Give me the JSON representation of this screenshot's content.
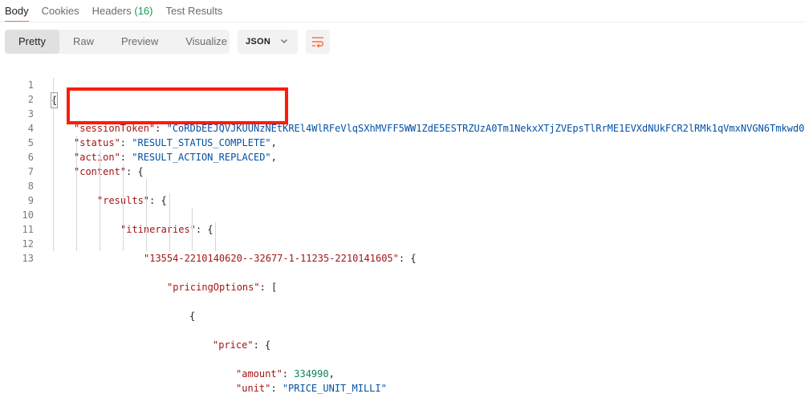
{
  "tabs": [
    {
      "label": "Body"
    },
    {
      "label": "Cookies"
    },
    {
      "label": "Headers",
      "count": "(16)"
    },
    {
      "label": "Test Results"
    }
  ],
  "view_modes": [
    "Pretty",
    "Raw",
    "Preview",
    "Visualize"
  ],
  "format": {
    "label": "JSON"
  },
  "icons": {
    "format_chevron": "chevron-down-icon",
    "wrap": "wrap-lines-icon"
  },
  "colors": {
    "accent": "#ff6c37",
    "highlight_box": "#ff1a0a",
    "key": "#a31515",
    "string": "#0451a5",
    "number": "#098658"
  },
  "code": {
    "line_numbers": [
      "1",
      "2",
      "3",
      "4",
      "5",
      "6",
      "7",
      "8",
      "9",
      "10",
      "11",
      "12",
      "13"
    ],
    "l1_open": "{",
    "l2_key": "\"sessionToken\"",
    "l2_value": "\"CoRDbEEJQVJKUUNzNEtKREl4WlRFeVlqSXhMVFF5WW1ZdE5ESTRZUzA0Tm1NekxXTjZVEpsTlRrME1EVXdNUkFCR2lRMk1qVmxNVGN6Tmkwd0",
    "l3_key": "\"status\"",
    "l3_value": "\"RESULT_STATUS_COMPLETE\"",
    "l4_key": "\"action\"",
    "l4_value": "\"RESULT_ACTION_REPLACED\"",
    "l5_key": "\"content\"",
    "l6_key": "\"results\"",
    "l7_key": "\"itineraries\"",
    "l8_key": "\"13554-2210140620--32677-1-11235-2210141605\"",
    "l9_key": "\"pricingOptions\"",
    "l10_open": "{",
    "l11_key": "\"price\"",
    "l12_key": "\"amount\"",
    "l12_value": "334990",
    "l13_key": "\"unit\"",
    "l13_value": "\"PRICE_UNIT_MILLI\""
  }
}
